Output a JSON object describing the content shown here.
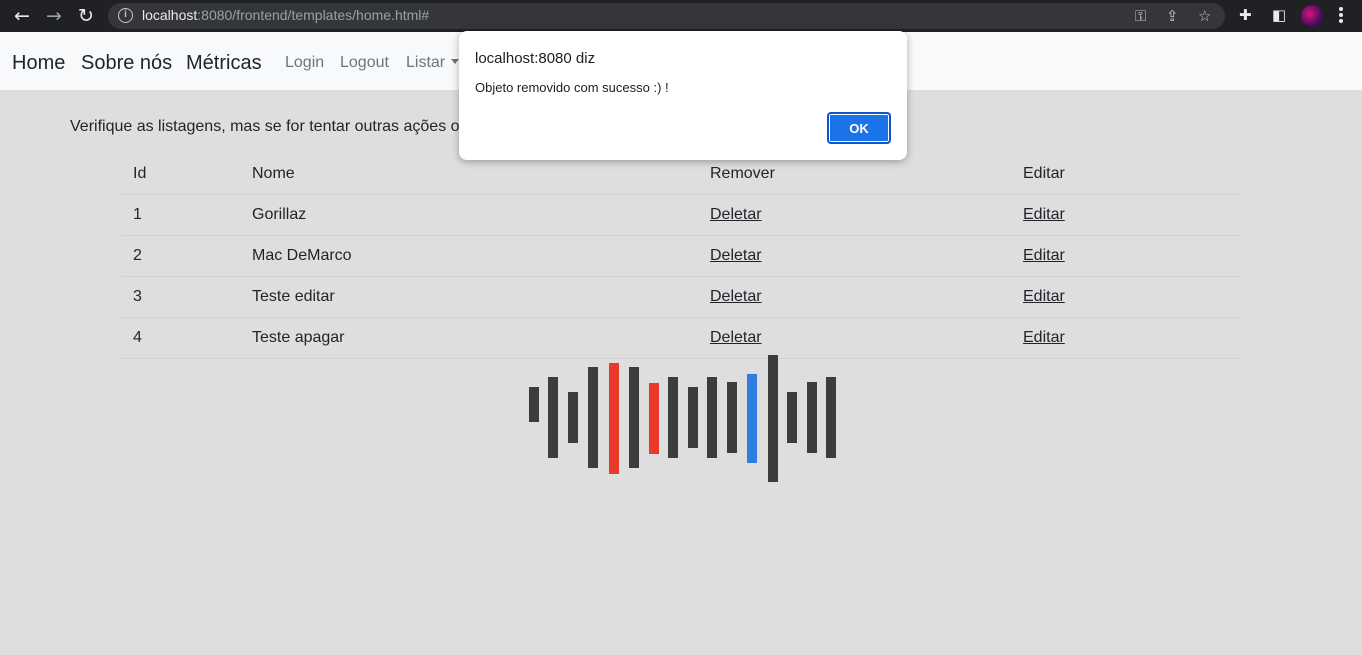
{
  "browser": {
    "url_host": "localhost",
    "url_rest": ":8080/frontend/templates/home.html#"
  },
  "navbar": {
    "home": "Home",
    "about": "Sobre nós",
    "metrics": "Métricas",
    "login": "Login",
    "logout": "Logout",
    "list": "Listar"
  },
  "main": {
    "notice": "Verifique as listagens, mas se for tentar outras ações o l"
  },
  "table": {
    "headers": [
      "Id",
      "Nome",
      "Remover",
      "Editar"
    ],
    "rows": [
      {
        "id": "1",
        "name": "Gorillaz",
        "remove": "Deletar",
        "edit": "Editar"
      },
      {
        "id": "2",
        "name": "Mac DeMarco",
        "remove": "Deletar",
        "edit": "Editar"
      },
      {
        "id": "3",
        "name": "Teste editar",
        "remove": "Deletar",
        "edit": "Editar"
      },
      {
        "id": "4",
        "name": "Teste apagar",
        "remove": "Deletar",
        "edit": "Editar"
      }
    ]
  },
  "logo": {
    "colors": {
      "dark": "#3c3c3c",
      "red": "#e8392b",
      "blue": "#2f7de1"
    }
  },
  "dialog": {
    "title": "localhost:8080 diz",
    "message": "Objeto removido com sucesso :) !",
    "ok_label": "OK"
  },
  "icons": [
    "back-icon",
    "forward-icon",
    "reload-icon",
    "info-icon",
    "key-icon",
    "share-icon",
    "star-icon",
    "extensions-icon",
    "sidepanel-icon",
    "profile-avatar",
    "menu-icon"
  ]
}
